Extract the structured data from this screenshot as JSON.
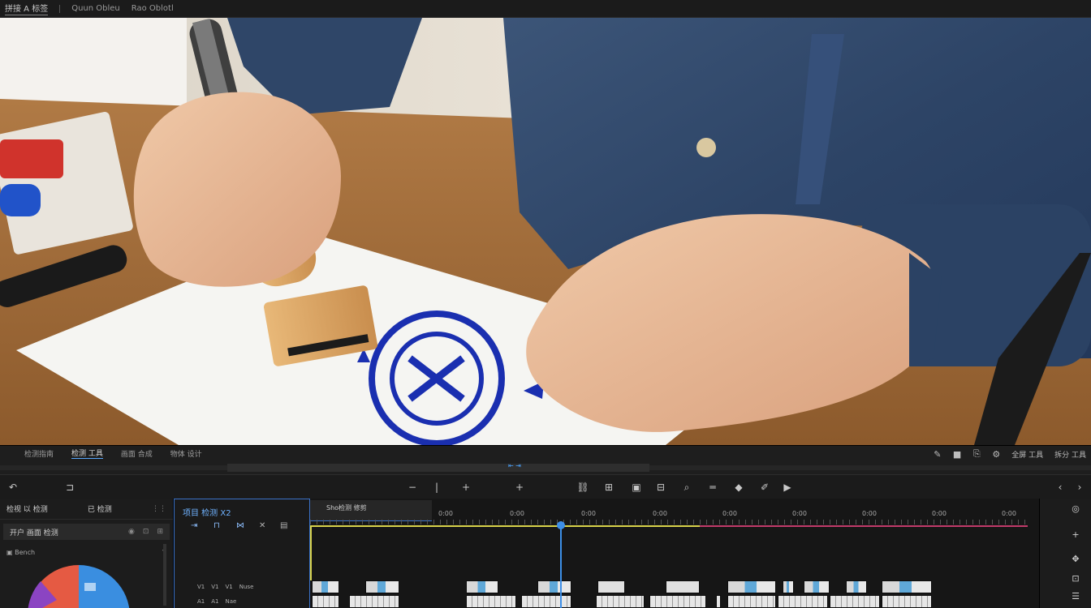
{
  "menu": {
    "items": [
      "拼接 A 标签",
      "Quun Obleu",
      "Rao Oblotl"
    ]
  },
  "preview_tabs": [
    "检测指南",
    "检测 工具",
    "画面 合成",
    "物体 设计"
  ],
  "preview_right_icons": [
    "pen-icon",
    "stop-icon",
    "export-icon",
    "settings-icon",
    "全屏 工具",
    "拆分 工具"
  ],
  "scrub_marker": "",
  "transport": {
    "left": [
      "undo-icon",
      "snap-icon"
    ],
    "center": [
      "−",
      "|",
      "+",
      "+"
    ],
    "right": [
      "link-icon",
      "split-icon",
      "marker-icon",
      "zoom-icon",
      "equal-icon",
      "fill-icon",
      "pencil-icon",
      "play-icon"
    ],
    "nav": [
      "‹",
      "›"
    ]
  },
  "left_panel": {
    "title": "检视 以 检测",
    "subtitle": "已 检测",
    "row_label": "开户 画面 检测",
    "sub_label": "Bench",
    "chart_colors": [
      "#e55a43",
      "#3a8ee0",
      "#8b44c2"
    ]
  },
  "timeline": {
    "panel_title": "项目 检测 X2",
    "sequence_tab": "Sho检测 修剪",
    "timecodes": [
      "0:00",
      "0:00",
      "0:00",
      "0:00",
      "0:00",
      "0:00",
      "0:00",
      "0:00",
      "0:00"
    ],
    "track1_labels": [
      "V1",
      "V1",
      "V1",
      "Nuse"
    ],
    "track2_labels": [
      "A1",
      "A1",
      "Nae"
    ]
  },
  "colors": {
    "accent": "#3d8fe8",
    "work_area": "#d8d24a",
    "work_area_end": "#c23a6a"
  }
}
